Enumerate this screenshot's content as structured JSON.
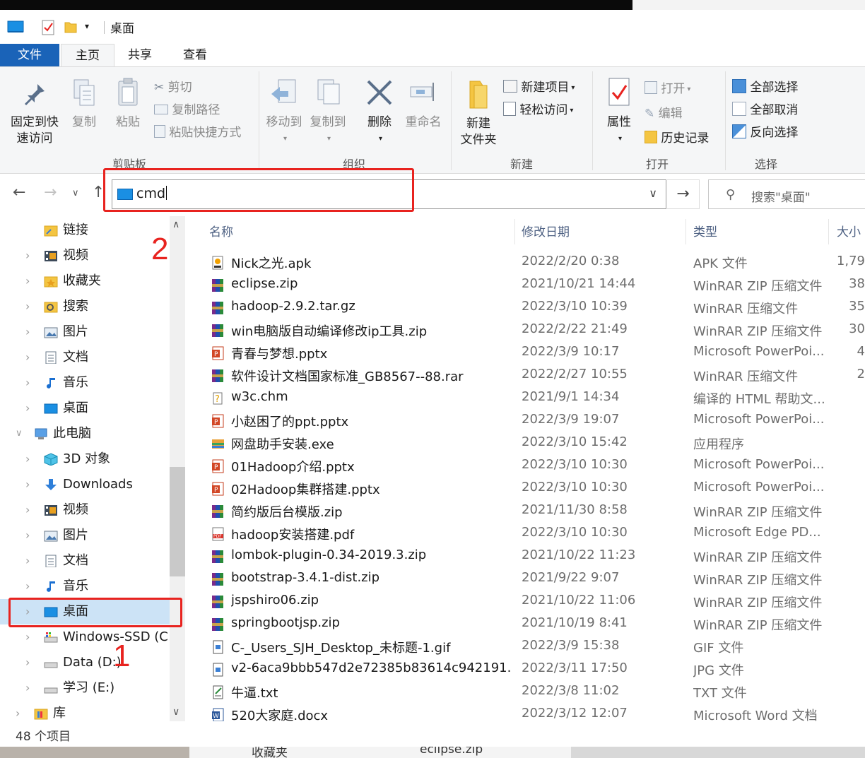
{
  "window": {
    "title": "桌面"
  },
  "tabs": {
    "file": "文件",
    "home": "主页",
    "share": "共享",
    "view": "查看"
  },
  "ribbon": {
    "clipboard": {
      "label": "剪贴板",
      "pin": "固定到快\n速访问",
      "pin_l1": "固定到快",
      "pin_l2": "速访问",
      "copy": "复制",
      "paste": "粘贴",
      "cut": "剪切",
      "copy_path": "复制路径",
      "paste_shortcut": "粘贴快捷方式"
    },
    "organize": {
      "label": "组织",
      "move_to": "移动到",
      "copy_to": "复制到",
      "delete": "删除",
      "rename": "重命名"
    },
    "new": {
      "label": "新建",
      "new_folder_l1": "新建",
      "new_folder_l2": "文件夹",
      "new_item": "新建项目",
      "easy_access": "轻松访问"
    },
    "open": {
      "label": "打开",
      "properties": "属性",
      "open": "打开",
      "edit": "编辑",
      "history": "历史记录"
    },
    "select": {
      "label": "选择",
      "select_all": "全部选择",
      "select_none": "全部取消",
      "invert": "反向选择"
    }
  },
  "address": {
    "value": "cmd",
    "search_placeholder": "搜索\"桌面\""
  },
  "annotations": {
    "one": "1",
    "two": "2"
  },
  "nav": [
    {
      "label": "链接",
      "icon": "link-folder-icon"
    },
    {
      "label": "视频",
      "icon": "video-icon"
    },
    {
      "label": "收藏夹",
      "icon": "favorites-icon"
    },
    {
      "label": "搜索",
      "icon": "search-folder-icon"
    },
    {
      "label": "图片",
      "icon": "pictures-icon"
    },
    {
      "label": "文档",
      "icon": "documents-icon"
    },
    {
      "label": "音乐",
      "icon": "music-icon"
    },
    {
      "label": "桌面",
      "icon": "desktop-icon"
    },
    {
      "label": "此电脑",
      "icon": "this-pc-icon"
    },
    {
      "label": "3D 对象",
      "icon": "3d-objects-icon"
    },
    {
      "label": "Downloads",
      "icon": "downloads-icon"
    },
    {
      "label": "视频",
      "icon": "video-icon"
    },
    {
      "label": "图片",
      "icon": "pictures-icon"
    },
    {
      "label": "文档",
      "icon": "documents-icon"
    },
    {
      "label": "音乐",
      "icon": "music-icon"
    },
    {
      "label": "桌面",
      "icon": "desktop-icon"
    },
    {
      "label": "Windows-SSD (C:",
      "icon": "drive-c-icon"
    },
    {
      "label": "Data (D:)",
      "icon": "drive-icon"
    },
    {
      "label": "学习 (E:)",
      "icon": "drive-icon"
    },
    {
      "label": "库",
      "icon": "library-icon"
    }
  ],
  "columns": {
    "name": "名称",
    "date": "修改日期",
    "type": "类型",
    "size": "大小"
  },
  "files": [
    {
      "name": "Nick之光.apk",
      "date": "2022/2/20 0:38",
      "type": "APK 文件",
      "size": "1,79",
      "icon": "apk-icon"
    },
    {
      "name": "eclipse.zip",
      "date": "2021/10/21 14:44",
      "type": "WinRAR ZIP 压缩文件",
      "size": "38",
      "icon": "winrar-icon"
    },
    {
      "name": "hadoop-2.9.2.tar.gz",
      "date": "2022/3/10 10:39",
      "type": "WinRAR 压缩文件",
      "size": "35",
      "icon": "winrar-icon"
    },
    {
      "name": "win电脑版自动编译修改ip工具.zip",
      "date": "2022/2/22 21:49",
      "type": "WinRAR ZIP 压缩文件",
      "size": "30",
      "icon": "winrar-icon"
    },
    {
      "name": "青春与梦想.pptx",
      "date": "2022/3/9 10:17",
      "type": "Microsoft PowerPoi...",
      "size": "4",
      "icon": "pptx-icon"
    },
    {
      "name": "软件设计文档国家标准_GB8567--88.rar",
      "date": "2022/2/27 10:55",
      "type": "WinRAR 压缩文件",
      "size": "2",
      "icon": "winrar-icon"
    },
    {
      "name": "w3c.chm",
      "date": "2021/9/1 14:34",
      "type": "编译的 HTML 帮助文...",
      "size": "",
      "icon": "chm-icon"
    },
    {
      "name": "小赵困了的ppt.pptx",
      "date": "2022/3/9 19:07",
      "type": "Microsoft PowerPoi...",
      "size": "",
      "icon": "pptx-icon"
    },
    {
      "name": "网盘助手安装.exe",
      "date": "2022/3/10 15:42",
      "type": "应用程序",
      "size": "",
      "icon": "exe-icon"
    },
    {
      "name": "01Hadoop介绍.pptx",
      "date": "2022/3/10 10:30",
      "type": "Microsoft PowerPoi...",
      "size": "",
      "icon": "pptx-icon"
    },
    {
      "name": "02Hadoop集群搭建.pptx",
      "date": "2022/3/10 10:30",
      "type": "Microsoft PowerPoi...",
      "size": "",
      "icon": "pptx-icon"
    },
    {
      "name": "简约版后台模版.zip",
      "date": "2021/11/30 8:58",
      "type": "WinRAR ZIP 压缩文件",
      "size": "",
      "icon": "winrar-icon"
    },
    {
      "name": "hadoop安装搭建.pdf",
      "date": "2022/3/10 10:30",
      "type": "Microsoft Edge PD...",
      "size": "",
      "icon": "pdf-icon"
    },
    {
      "name": "lombok-plugin-0.34-2019.3.zip",
      "date": "2021/10/22 11:23",
      "type": "WinRAR ZIP 压缩文件",
      "size": "",
      "icon": "winrar-icon"
    },
    {
      "name": "bootstrap-3.4.1-dist.zip",
      "date": "2021/9/22 9:07",
      "type": "WinRAR ZIP 压缩文件",
      "size": "",
      "icon": "winrar-icon"
    },
    {
      "name": "jspshiro06.zip",
      "date": "2021/10/22 11:06",
      "type": "WinRAR ZIP 压缩文件",
      "size": "",
      "icon": "winrar-icon"
    },
    {
      "name": "springbootjsp.zip",
      "date": "2021/10/19 8:41",
      "type": "WinRAR ZIP 压缩文件",
      "size": "",
      "icon": "winrar-icon"
    },
    {
      "name": "C-_Users_SJH_Desktop_未标题-1.gif",
      "date": "2022/3/9 15:38",
      "type": "GIF 文件",
      "size": "",
      "icon": "gif-icon"
    },
    {
      "name": "v2-6aca9bbb547d2e72385b83614c942191...",
      "date": "2022/3/11 17:50",
      "type": "JPG 文件",
      "size": "",
      "icon": "jpg-icon"
    },
    {
      "name": "牛逼.txt",
      "date": "2022/3/8 11:02",
      "type": "TXT 文件",
      "size": "",
      "icon": "txt-icon"
    },
    {
      "name": "520大家庭.docx",
      "date": "2022/3/12 12:07",
      "type": "Microsoft Word 文档",
      "size": "",
      "icon": "docx-icon"
    }
  ],
  "status": {
    "count": "48 个项目"
  },
  "background": {
    "left_text": "收藏夹",
    "right_text": "eclipse.zip"
  },
  "colors": {
    "accent": "#1a63b8",
    "annotation": "#e8231f",
    "selection": "#cce3f6"
  }
}
